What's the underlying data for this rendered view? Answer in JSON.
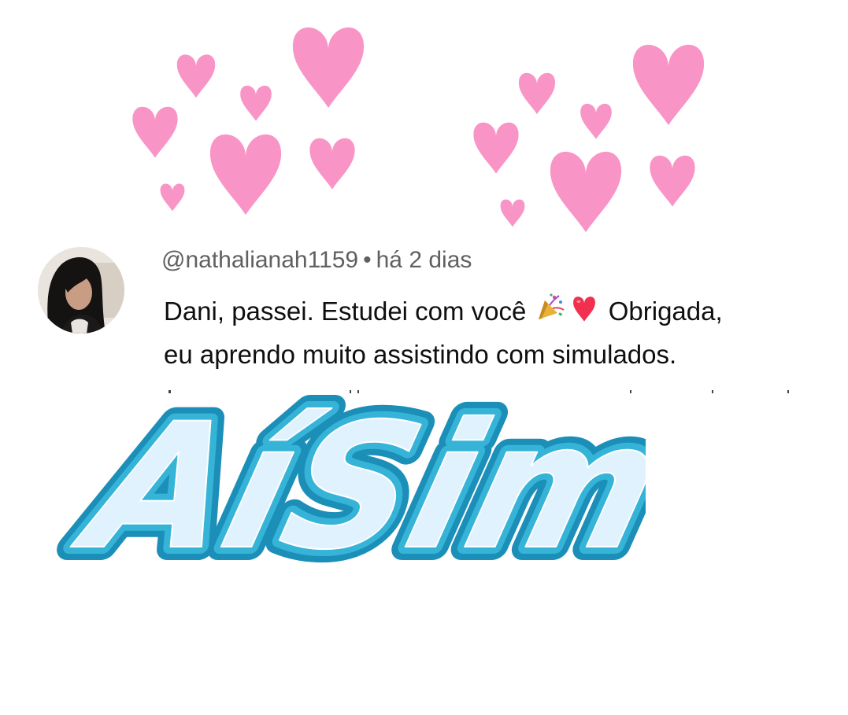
{
  "colors": {
    "heart_pink": "#f994c6",
    "logo_fill": "#dff2fd",
    "logo_outline": "#1c8fb9",
    "meta_gray": "#606060",
    "text_black": "#0f0f0f"
  },
  "comment": {
    "username": "@nathalianah1159",
    "separator": "•",
    "time_ago": "há 2 dias",
    "text_part1": "Dani, passei. Estudei com você ",
    "emoji_party": "party-popper-emoji",
    "emoji_heart": "red-heart-emoji",
    "text_part2": " Obrigada,",
    "text_line2": "eu aprendo muito assistindo com simulados."
  },
  "logo": {
    "text": "AíSim"
  },
  "icons": {
    "avatar": "profile-photo",
    "hearts": "decorative-pink-hearts"
  }
}
